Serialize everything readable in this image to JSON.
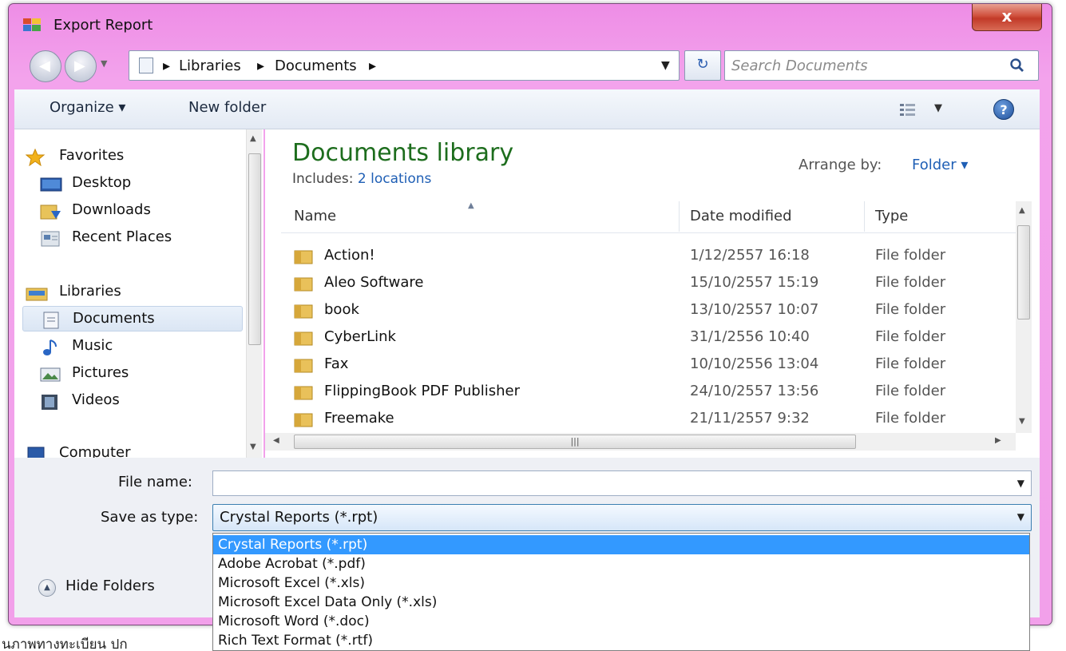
{
  "window": {
    "title": "Export Report",
    "close_label": "x"
  },
  "address": {
    "crumbs": [
      "Libraries",
      "Documents"
    ],
    "search_placeholder": "Search Documents"
  },
  "toolbar": {
    "organize_label": "Organize ▾",
    "new_folder_label": "New folder"
  },
  "nav": {
    "favorites_label": "Favorites",
    "desktop_label": "Desktop",
    "downloads_label": "Downloads",
    "recent_label": "Recent Places",
    "libraries_label": "Libraries",
    "documents_label": "Documents",
    "music_label": "Music",
    "pictures_label": "Pictures",
    "videos_label": "Videos",
    "computer_label": "Computer"
  },
  "content": {
    "title": "Documents library",
    "includes_prefix": "Includes:",
    "includes_link": "2 locations",
    "arrange_label": "Arrange by:",
    "arrange_value": "Folder ▾",
    "columns": {
      "name": "Name",
      "date": "Date modified",
      "type": "Type"
    },
    "rows": [
      {
        "name": "Action!",
        "date": "1/12/2557 16:18",
        "type": "File folder"
      },
      {
        "name": "Aleo Software",
        "date": "15/10/2557 15:19",
        "type": "File folder"
      },
      {
        "name": "book",
        "date": "13/10/2557 10:07",
        "type": "File folder"
      },
      {
        "name": "CyberLink",
        "date": "31/1/2556 10:40",
        "type": "File folder"
      },
      {
        "name": "Fax",
        "date": "10/10/2556 13:04",
        "type": "File folder"
      },
      {
        "name": "FlippingBook PDF Publisher",
        "date": "24/10/2557 13:56",
        "type": "File folder"
      },
      {
        "name": "Freemake",
        "date": "21/11/2557 9:32",
        "type": "File folder"
      }
    ]
  },
  "form": {
    "filename_label": "File name:",
    "filename_value": "",
    "savetype_label": "Save as type:",
    "savetype_value": "Crystal Reports (*.rpt)",
    "hide_folders_label": "Hide Folders",
    "type_options": [
      "Crystal Reports (*.rpt)",
      "Adobe Acrobat (*.pdf)",
      "Microsoft Excel (*.xls)",
      "Microsoft Excel Data Only (*.xls)",
      "Microsoft Word (*.doc)",
      "Rich Text Format (*.rtf)"
    ]
  },
  "background": {
    "thai_text": "นภาพทางทะเบียน   ปก"
  },
  "colors": {
    "window_frame": "#f2a0ea",
    "library_title": "#1d6d1d",
    "link": "#1f5fb5",
    "selection": "#3399ff"
  }
}
